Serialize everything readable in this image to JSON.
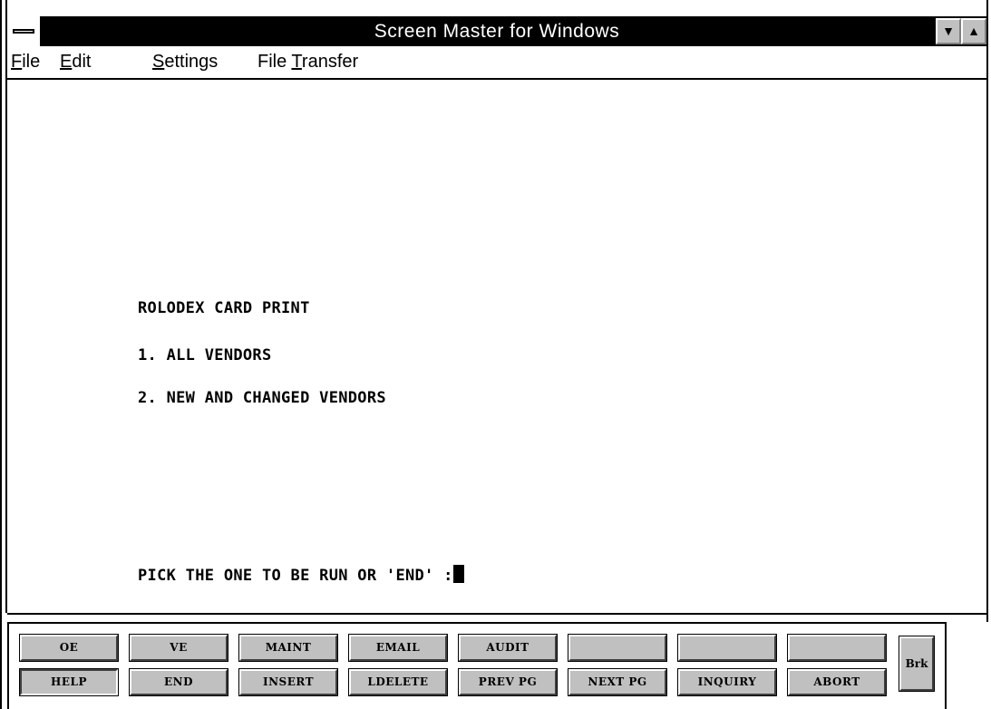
{
  "window": {
    "title": "Screen Master for Windows",
    "minimize_glyph": "▼",
    "maximize_glyph": "▲"
  },
  "menu": {
    "items": [
      {
        "label_pre": "",
        "label_ul": "F",
        "label_post": "ile"
      },
      {
        "label_pre": "",
        "label_ul": "E",
        "label_post": "dit"
      },
      {
        "label_pre": "",
        "label_ul": "S",
        "label_post": "ettings"
      },
      {
        "label_pre": "File ",
        "label_ul": "T",
        "label_post": "ransfer"
      }
    ]
  },
  "screen": {
    "heading": "ROLODEX CARD PRINT",
    "option1": "1. ALL VENDORS",
    "option2": "2. NEW AND CHANGED VENDORS",
    "prompt": "PICK THE ONE TO BE RUN OR 'END' :"
  },
  "fkeys": {
    "row1": [
      "OE",
      "VE",
      "MAINT",
      "EMAIL",
      "AUDIT",
      "",
      "",
      ""
    ],
    "row2": [
      "HELP",
      "END",
      "INSERT",
      "LDELETE",
      "PREV PG",
      "NEXT PG",
      "INQUIRY",
      "ABORT"
    ],
    "brk": "Brk"
  }
}
